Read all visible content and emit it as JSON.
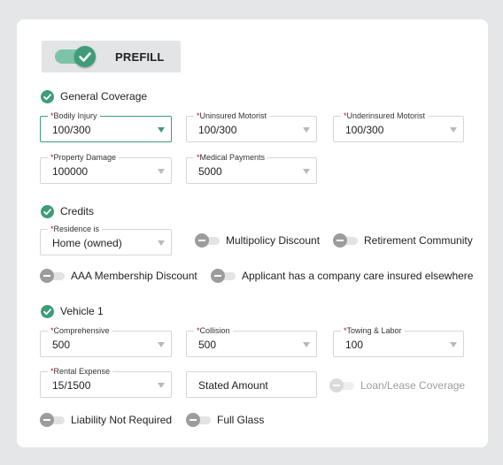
{
  "prefill": {
    "label": "PREFILL",
    "on": true
  },
  "sections": {
    "general": "General Coverage",
    "credits": "Credits",
    "vehicle": "Vehicle 1"
  },
  "required_mark": "*",
  "general": {
    "bodily_injury": {
      "label": "Bodily Injury",
      "value": "100/300"
    },
    "uninsured": {
      "label": "Uninsured Motorist",
      "value": "100/300"
    },
    "underinsured": {
      "label": "Underinsured Motorist",
      "value": "100/300"
    },
    "property": {
      "label": "Property Damage",
      "value": "100000"
    },
    "medical": {
      "label": "Medical Payments",
      "value": "5000"
    }
  },
  "credits": {
    "residence": {
      "label": "Residence is",
      "value": "Home (owned)"
    },
    "multipolicy": "Multipolicy Discount",
    "retirement": "Retirement Community",
    "aaa": "AAA Membership Discount",
    "applicant": "Applicant has a company care insured elsewhere"
  },
  "vehicle": {
    "comprehensive": {
      "label": "Comprehensive",
      "value": "500"
    },
    "collision": {
      "label": "Collision",
      "value": "500"
    },
    "towing": {
      "label": "Towing & Labor",
      "value": "100"
    },
    "rental": {
      "label": "Rental Expense",
      "value": "15/1500"
    },
    "stated_amount": "Stated Amount",
    "loan_lease": "Loan/Lease Coverage",
    "liability_not_required": "Liability Not Required",
    "full_glass": "Full Glass"
  },
  "colors": {
    "accent": "#3f9c78",
    "required": "#d0021b",
    "toggle_off": "#9c9c9c"
  },
  "icons": {
    "check": "check-circle-icon",
    "dropdown": "chevron-down-icon"
  }
}
